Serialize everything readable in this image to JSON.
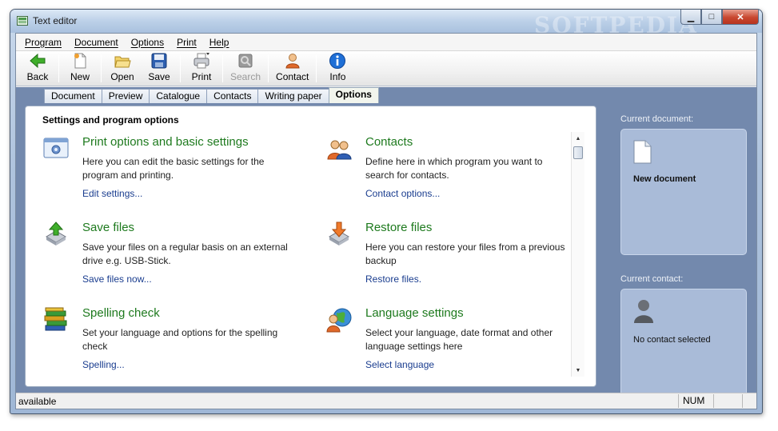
{
  "window": {
    "title": "Text editor",
    "watermark": "SOFTPEDIA"
  },
  "window_buttons": {
    "minimize": "▁",
    "maximize": "□",
    "close": "✕"
  },
  "menubar": [
    "Program",
    "Document",
    "Options",
    "Print",
    "Help"
  ],
  "toolbar": {
    "back": "Back",
    "new": "New",
    "open": "Open",
    "save": "Save",
    "print": "Print",
    "search": "Search",
    "contact": "Contact",
    "info": "Info"
  },
  "tabs": [
    "Document",
    "Preview",
    "Catalogue",
    "Contacts",
    "Writing paper",
    "Options"
  ],
  "active_tab": "Options",
  "panel": {
    "title": "Settings and program options",
    "options": [
      {
        "title": "Print options and basic settings",
        "desc": "Here you can edit the basic settings for the program and printing.",
        "link": "Edit settings...",
        "icon": "settings-icon"
      },
      {
        "title": "Contacts",
        "desc": "Define here in which program you want to search for contacts.",
        "link": "Contact options...",
        "icon": "contacts-icon"
      },
      {
        "title": "Save files",
        "desc": "Save your files on a regular basis on an external drive e.g.  USB-Stick.",
        "link": "Save files now...",
        "icon": "save-files-icon"
      },
      {
        "title": "Restore files",
        "desc": "Here you can restore your files from a previous backup",
        "link": "Restore files.",
        "icon": "restore-files-icon"
      },
      {
        "title": "Spelling check",
        "desc": "Set your language and options for the spelling check",
        "link": "Spelling...",
        "icon": "books-icon"
      },
      {
        "title": "Language settings",
        "desc": "Select your language, date format and other language settings here",
        "link": "Select language",
        "icon": "language-icon"
      }
    ]
  },
  "sidebar": {
    "doc_label": "Current document:",
    "doc_name": "New document",
    "contact_label": "Current contact:",
    "contact_name": "No contact selected"
  },
  "statusbar": {
    "text": "available",
    "num": "NUM"
  },
  "colors": {
    "link": "#1a3d8f",
    "option_title": "#1e7a1e",
    "main_bg": "#7389ad",
    "sidebar_box": "#a9bbd8"
  }
}
